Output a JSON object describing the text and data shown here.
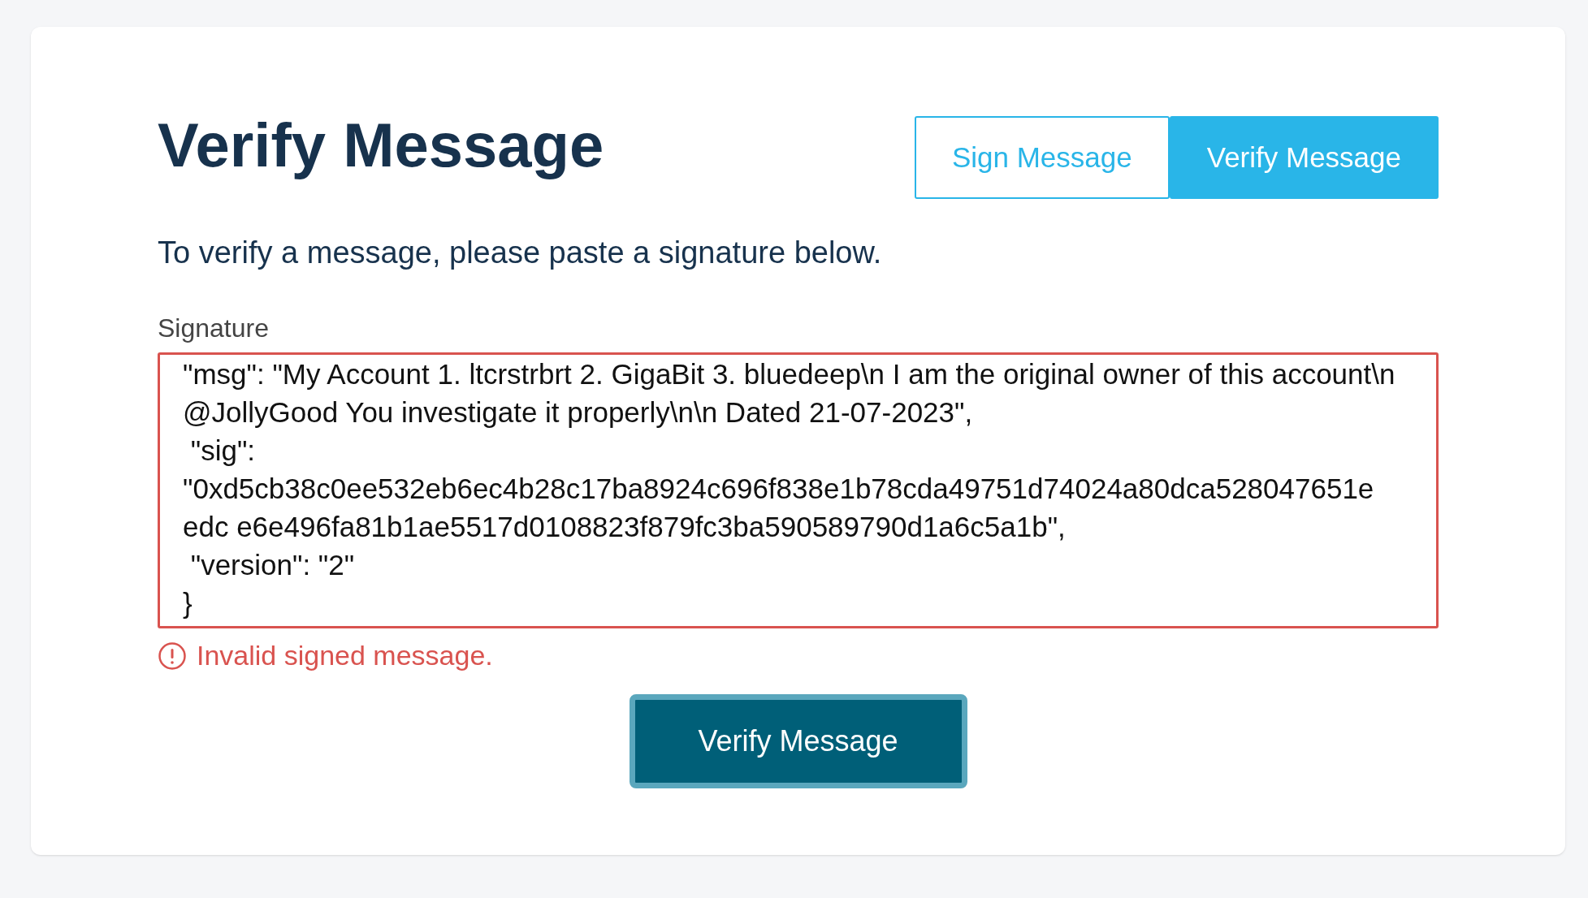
{
  "title": "Verify Message",
  "tabs": [
    {
      "label": "Sign Message",
      "selected": false
    },
    {
      "label": "Verify Message",
      "selected": true
    }
  ],
  "description": "To verify a message, please paste a signature below.",
  "signature": {
    "label": "Signature",
    "invalid": true,
    "value_lines": [
      "\"msg\": \"My Account 1. ltcrstrbrt 2. GigaBit 3. bluedeep\\n I am the original owner of this account\\n",
      "@JollyGood You investigate it properly\\n\\n Dated 21-07-2023\",",
      " \"sig\":",
      "\"0xd5cb38c0ee532eb6ec4b28c17ba8924c696f838e1b78cda49751d74024a80dca528047651e",
      "edc e6e496fa81b1ae5517d0108823f879fc3ba590589790d1a6c5a1b\",",
      " \"version\": \"2\"",
      "}"
    ]
  },
  "error": "Invalid signed message.",
  "submit_button": "Verify Message"
}
